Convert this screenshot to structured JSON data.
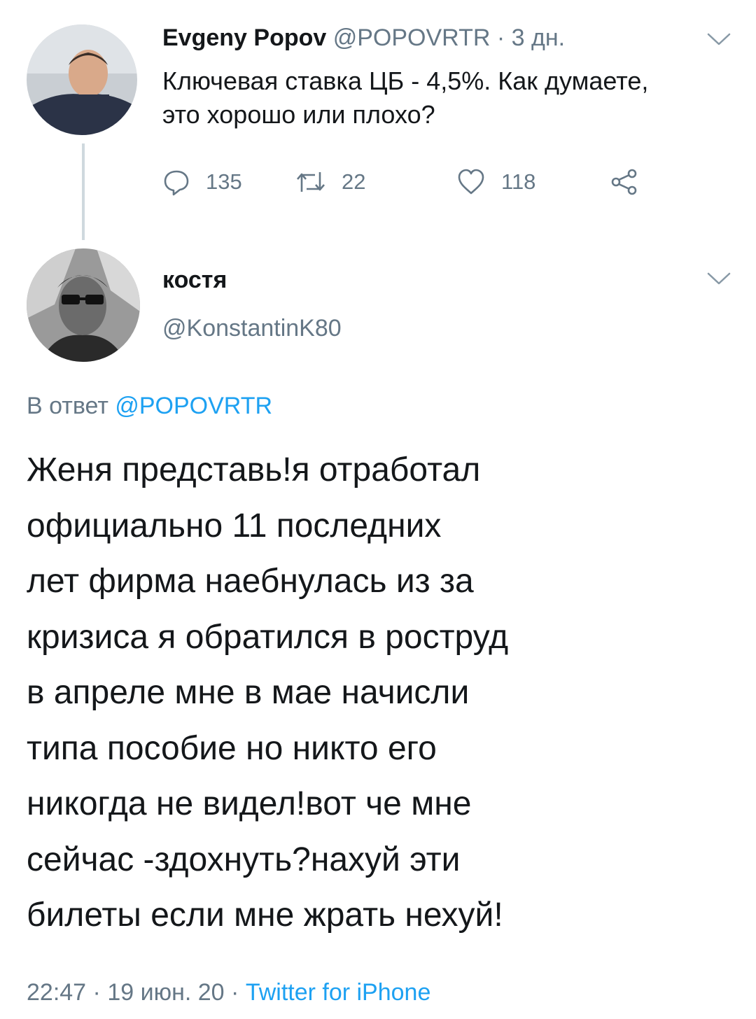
{
  "parent_tweet": {
    "author_name": "Evgeny Popov",
    "author_handle": "@POPOVRTR",
    "separator": "·",
    "time_ago": "3 дн.",
    "text": "Ключевая ставка ЦБ - 4,5%. Как думаете, это хорошо или плохо?",
    "reply_count": "135",
    "retweet_count": "22",
    "like_count": "118",
    "avatar_icon": "person-photo-avatar",
    "more_icon": "chevron-down-icon"
  },
  "reply_tweet": {
    "author_name": "костя",
    "author_handle": "@KonstantinK80",
    "replying_to_label": "В ответ",
    "replying_to_handle": "@POPOVRTR",
    "text_lines": [
      "Женя представь!я отработал",
      "официально 11 последних",
      "лет фирма наебнулась из за",
      "кризиса я обратился в роструд",
      "в апреле мне  в мае начисли",
      "типа пособие но никто его",
      "никогда не видел!вот че мне",
      "сейчас -здохнуть?нахуй эти",
      "билеты если мне жрать нехуй!"
    ],
    "time": "22:47",
    "separator": "·",
    "date": "19 июн. 20",
    "source": "Twitter for iPhone",
    "avatar_icon": "person-photo-avatar",
    "more_icon": "chevron-down-icon"
  },
  "colors": {
    "text_primary": "#14171a",
    "text_secondary": "#657786",
    "link": "#1da1f2",
    "thread_line": "#cfd9de"
  }
}
